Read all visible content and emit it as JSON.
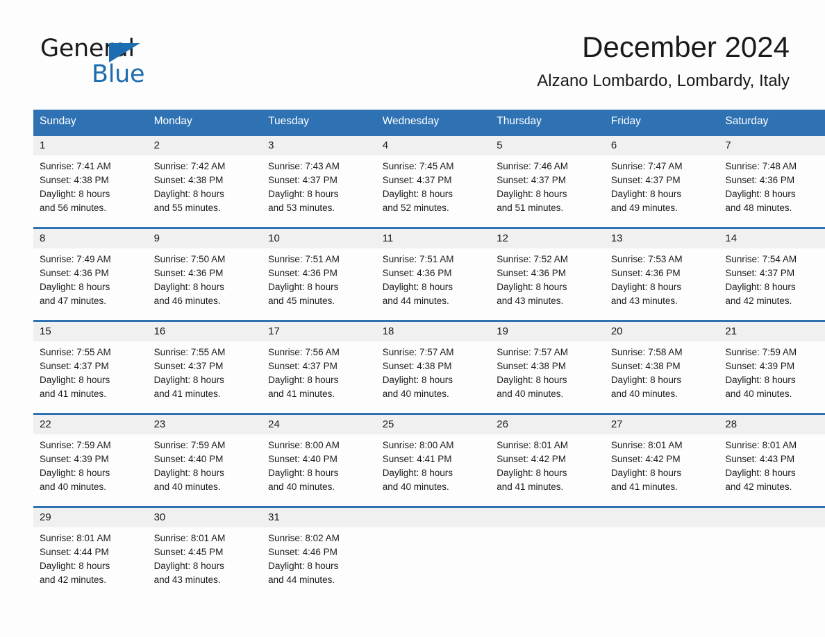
{
  "brand": {
    "name_part1": "General",
    "name_part2": "Blue",
    "triangle_color": "#1b6cb0"
  },
  "header": {
    "title": "December 2024",
    "subtitle": "Alzano Lombardo, Lombardy, Italy"
  },
  "theme": {
    "header_blue": "#2e72b4",
    "daynum_band": "#f0f0f0",
    "page_background": "#fdfdfd",
    "text": "#1a1a1a"
  },
  "weekday_headers": [
    "Sunday",
    "Monday",
    "Tuesday",
    "Wednesday",
    "Thursday",
    "Friday",
    "Saturday"
  ],
  "weeks": [
    [
      {
        "day": "1",
        "sunrise": "Sunrise: 7:41 AM",
        "sunset": "Sunset: 4:38 PM",
        "daylight_line1": "Daylight: 8 hours",
        "daylight_line2": "and 56 minutes."
      },
      {
        "day": "2",
        "sunrise": "Sunrise: 7:42 AM",
        "sunset": "Sunset: 4:38 PM",
        "daylight_line1": "Daylight: 8 hours",
        "daylight_line2": "and 55 minutes."
      },
      {
        "day": "3",
        "sunrise": "Sunrise: 7:43 AM",
        "sunset": "Sunset: 4:37 PM",
        "daylight_line1": "Daylight: 8 hours",
        "daylight_line2": "and 53 minutes."
      },
      {
        "day": "4",
        "sunrise": "Sunrise: 7:45 AM",
        "sunset": "Sunset: 4:37 PM",
        "daylight_line1": "Daylight: 8 hours",
        "daylight_line2": "and 52 minutes."
      },
      {
        "day": "5",
        "sunrise": "Sunrise: 7:46 AM",
        "sunset": "Sunset: 4:37 PM",
        "daylight_line1": "Daylight: 8 hours",
        "daylight_line2": "and 51 minutes."
      },
      {
        "day": "6",
        "sunrise": "Sunrise: 7:47 AM",
        "sunset": "Sunset: 4:37 PM",
        "daylight_line1": "Daylight: 8 hours",
        "daylight_line2": "and 49 minutes."
      },
      {
        "day": "7",
        "sunrise": "Sunrise: 7:48 AM",
        "sunset": "Sunset: 4:36 PM",
        "daylight_line1": "Daylight: 8 hours",
        "daylight_line2": "and 48 minutes."
      }
    ],
    [
      {
        "day": "8",
        "sunrise": "Sunrise: 7:49 AM",
        "sunset": "Sunset: 4:36 PM",
        "daylight_line1": "Daylight: 8 hours",
        "daylight_line2": "and 47 minutes."
      },
      {
        "day": "9",
        "sunrise": "Sunrise: 7:50 AM",
        "sunset": "Sunset: 4:36 PM",
        "daylight_line1": "Daylight: 8 hours",
        "daylight_line2": "and 46 minutes."
      },
      {
        "day": "10",
        "sunrise": "Sunrise: 7:51 AM",
        "sunset": "Sunset: 4:36 PM",
        "daylight_line1": "Daylight: 8 hours",
        "daylight_line2": "and 45 minutes."
      },
      {
        "day": "11",
        "sunrise": "Sunrise: 7:51 AM",
        "sunset": "Sunset: 4:36 PM",
        "daylight_line1": "Daylight: 8 hours",
        "daylight_line2": "and 44 minutes."
      },
      {
        "day": "12",
        "sunrise": "Sunrise: 7:52 AM",
        "sunset": "Sunset: 4:36 PM",
        "daylight_line1": "Daylight: 8 hours",
        "daylight_line2": "and 43 minutes."
      },
      {
        "day": "13",
        "sunrise": "Sunrise: 7:53 AM",
        "sunset": "Sunset: 4:36 PM",
        "daylight_line1": "Daylight: 8 hours",
        "daylight_line2": "and 43 minutes."
      },
      {
        "day": "14",
        "sunrise": "Sunrise: 7:54 AM",
        "sunset": "Sunset: 4:37 PM",
        "daylight_line1": "Daylight: 8 hours",
        "daylight_line2": "and 42 minutes."
      }
    ],
    [
      {
        "day": "15",
        "sunrise": "Sunrise: 7:55 AM",
        "sunset": "Sunset: 4:37 PM",
        "daylight_line1": "Daylight: 8 hours",
        "daylight_line2": "and 41 minutes."
      },
      {
        "day": "16",
        "sunrise": "Sunrise: 7:55 AM",
        "sunset": "Sunset: 4:37 PM",
        "daylight_line1": "Daylight: 8 hours",
        "daylight_line2": "and 41 minutes."
      },
      {
        "day": "17",
        "sunrise": "Sunrise: 7:56 AM",
        "sunset": "Sunset: 4:37 PM",
        "daylight_line1": "Daylight: 8 hours",
        "daylight_line2": "and 41 minutes."
      },
      {
        "day": "18",
        "sunrise": "Sunrise: 7:57 AM",
        "sunset": "Sunset: 4:38 PM",
        "daylight_line1": "Daylight: 8 hours",
        "daylight_line2": "and 40 minutes."
      },
      {
        "day": "19",
        "sunrise": "Sunrise: 7:57 AM",
        "sunset": "Sunset: 4:38 PM",
        "daylight_line1": "Daylight: 8 hours",
        "daylight_line2": "and 40 minutes."
      },
      {
        "day": "20",
        "sunrise": "Sunrise: 7:58 AM",
        "sunset": "Sunset: 4:38 PM",
        "daylight_line1": "Daylight: 8 hours",
        "daylight_line2": "and 40 minutes."
      },
      {
        "day": "21",
        "sunrise": "Sunrise: 7:59 AM",
        "sunset": "Sunset: 4:39 PM",
        "daylight_line1": "Daylight: 8 hours",
        "daylight_line2": "and 40 minutes."
      }
    ],
    [
      {
        "day": "22",
        "sunrise": "Sunrise: 7:59 AM",
        "sunset": "Sunset: 4:39 PM",
        "daylight_line1": "Daylight: 8 hours",
        "daylight_line2": "and 40 minutes."
      },
      {
        "day": "23",
        "sunrise": "Sunrise: 7:59 AM",
        "sunset": "Sunset: 4:40 PM",
        "daylight_line1": "Daylight: 8 hours",
        "daylight_line2": "and 40 minutes."
      },
      {
        "day": "24",
        "sunrise": "Sunrise: 8:00 AM",
        "sunset": "Sunset: 4:40 PM",
        "daylight_line1": "Daylight: 8 hours",
        "daylight_line2": "and 40 minutes."
      },
      {
        "day": "25",
        "sunrise": "Sunrise: 8:00 AM",
        "sunset": "Sunset: 4:41 PM",
        "daylight_line1": "Daylight: 8 hours",
        "daylight_line2": "and 40 minutes."
      },
      {
        "day": "26",
        "sunrise": "Sunrise: 8:01 AM",
        "sunset": "Sunset: 4:42 PM",
        "daylight_line1": "Daylight: 8 hours",
        "daylight_line2": "and 41 minutes."
      },
      {
        "day": "27",
        "sunrise": "Sunrise: 8:01 AM",
        "sunset": "Sunset: 4:42 PM",
        "daylight_line1": "Daylight: 8 hours",
        "daylight_line2": "and 41 minutes."
      },
      {
        "day": "28",
        "sunrise": "Sunrise: 8:01 AM",
        "sunset": "Sunset: 4:43 PM",
        "daylight_line1": "Daylight: 8 hours",
        "daylight_line2": "and 42 minutes."
      }
    ],
    [
      {
        "day": "29",
        "sunrise": "Sunrise: 8:01 AM",
        "sunset": "Sunset: 4:44 PM",
        "daylight_line1": "Daylight: 8 hours",
        "daylight_line2": "and 42 minutes."
      },
      {
        "day": "30",
        "sunrise": "Sunrise: 8:01 AM",
        "sunset": "Sunset: 4:45 PM",
        "daylight_line1": "Daylight: 8 hours",
        "daylight_line2": "and 43 minutes."
      },
      {
        "day": "31",
        "sunrise": "Sunrise: 8:02 AM",
        "sunset": "Sunset: 4:46 PM",
        "daylight_line1": "Daylight: 8 hours",
        "daylight_line2": "and 44 minutes."
      },
      {
        "day": "",
        "sunrise": "",
        "sunset": "",
        "daylight_line1": "",
        "daylight_line2": ""
      },
      {
        "day": "",
        "sunrise": "",
        "sunset": "",
        "daylight_line1": "",
        "daylight_line2": ""
      },
      {
        "day": "",
        "sunrise": "",
        "sunset": "",
        "daylight_line1": "",
        "daylight_line2": ""
      },
      {
        "day": "",
        "sunrise": "",
        "sunset": "",
        "daylight_line1": "",
        "daylight_line2": ""
      }
    ]
  ]
}
